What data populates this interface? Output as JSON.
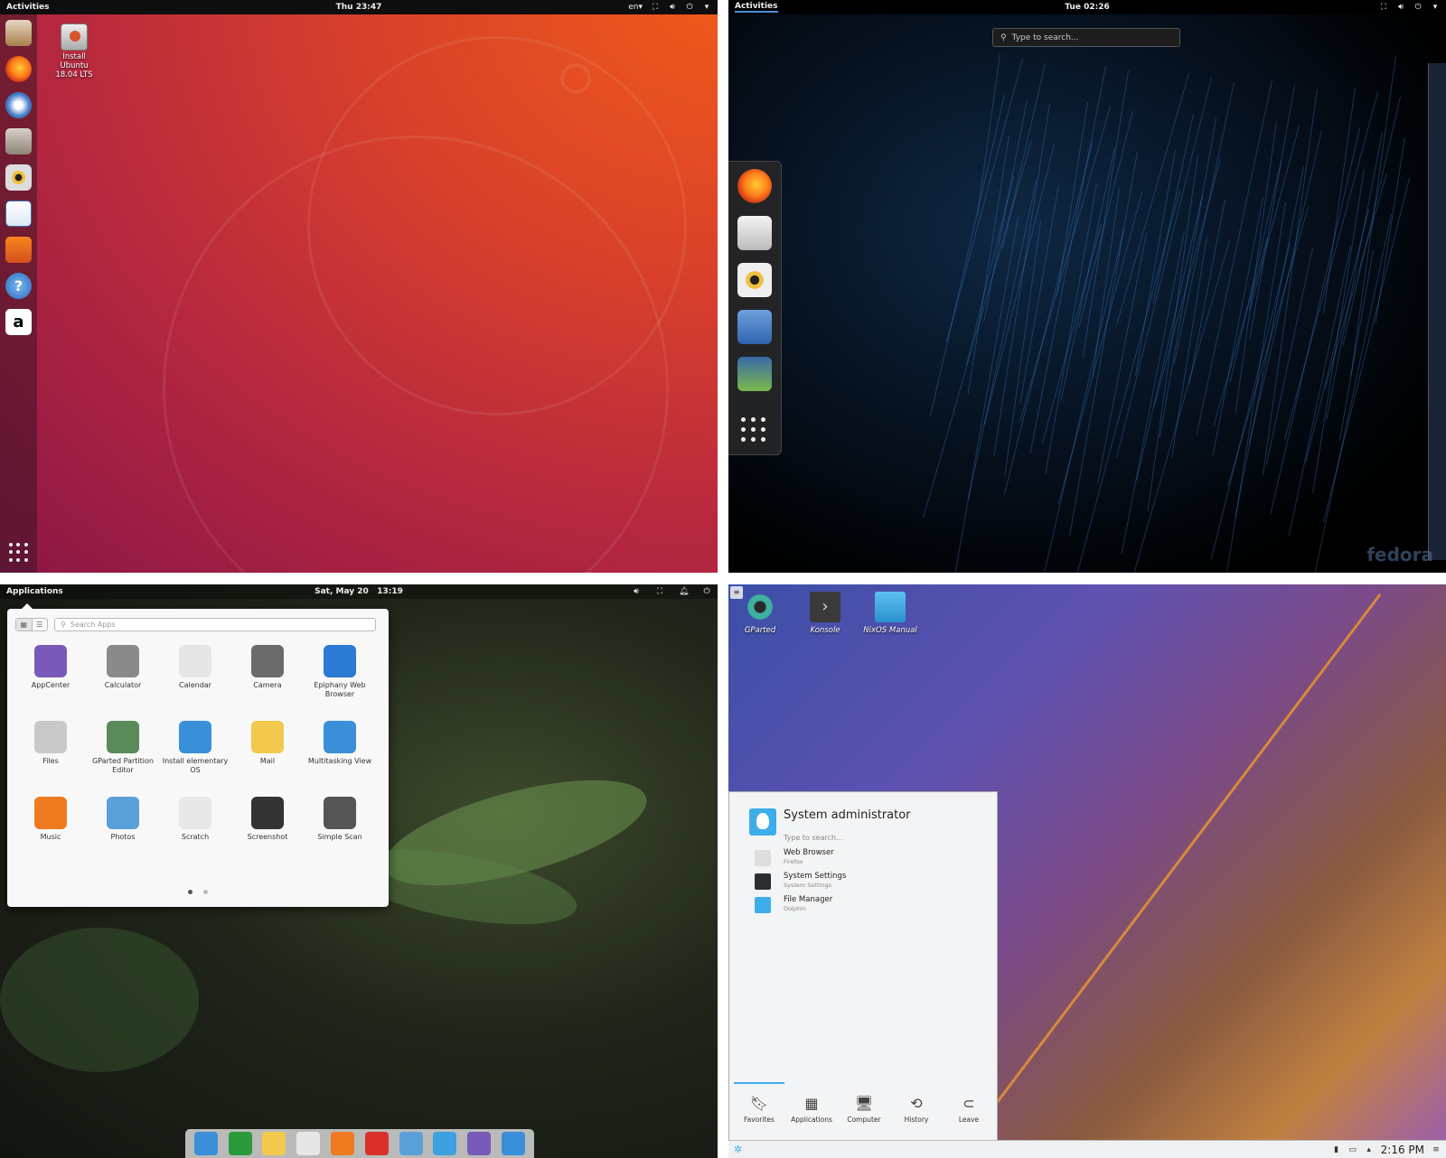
{
  "ubuntu": {
    "topbar": {
      "activities": "Activities",
      "clock": "Thu 23:47",
      "lang": "en",
      "caret": "▾"
    },
    "desktop_icon_label": "Install\nUbuntu\n18.04 LTS",
    "dock_icons": [
      "software-updater-icon",
      "firefox-icon",
      "thunderbird-icon",
      "files-icon",
      "rhythmbox-icon",
      "libreoffice-writer-icon",
      "ubuntu-software-icon",
      "help-icon",
      "amazon-icon"
    ],
    "colors": {
      "accent": "#e95420",
      "background_bottom": "#77216f"
    }
  },
  "fedora": {
    "topbar": {
      "activities": "Activities",
      "clock": "Tue 02:26"
    },
    "search_placeholder": "Type to search...",
    "dock_icons": [
      "firefox-icon",
      "evolution-icon",
      "rhythmbox-icon",
      "files-icon",
      "fedora-installer-icon"
    ],
    "watermark": "fedora"
  },
  "elementary": {
    "topbar": {
      "applications": "Applications",
      "date": "Sat, May 20",
      "time": "13:19"
    },
    "search_placeholder": "Search Apps",
    "apps": [
      {
        "label": "AppCenter",
        "color": "#7a5ab8"
      },
      {
        "label": "Calculator",
        "color": "#8a8a8a"
      },
      {
        "label": "Calendar",
        "color": "#e6e6e6"
      },
      {
        "label": "Camera",
        "color": "#6b6b6b"
      },
      {
        "label": "Epiphany Web Browser",
        "color": "#2b7bd4"
      },
      {
        "label": "Files",
        "color": "#c9c9c9"
      },
      {
        "label": "GParted Partition Editor",
        "color": "#5a8a5a"
      },
      {
        "label": "Install elementary OS",
        "color": "#3a8fd9"
      },
      {
        "label": "Mail",
        "color": "#f2c94c"
      },
      {
        "label": "Multitasking View",
        "color": "#3b8fd8"
      },
      {
        "label": "Music",
        "color": "#f07a20"
      },
      {
        "label": "Photos",
        "color": "#5aa0d8"
      },
      {
        "label": "Scratch",
        "color": "#e8e8e8"
      },
      {
        "label": "Screenshot",
        "color": "#333333"
      },
      {
        "label": "Simple Scan",
        "color": "#555555"
      }
    ],
    "dock_colors": [
      "#3b8fd8",
      "#2b9a3b",
      "#f2c94c",
      "#e6e6e6",
      "#f07a20",
      "#d9302c",
      "#5aa0d8",
      "#3da0e0",
      "#7a5ab8",
      "#3a8fd9"
    ]
  },
  "kde": {
    "desktop_icons": [
      {
        "label": "GParted",
        "color": "#3a6a6a"
      },
      {
        "label": "Konsole",
        "color": "#3a3a3a"
      },
      {
        "label": "NixOS Manual",
        "color": "#3daee9"
      }
    ],
    "user": "System administrator",
    "search_placeholder": "Type to search...",
    "favorites": [
      {
        "title": "Web Browser",
        "subtitle": "Firefox",
        "color": "#dddddd"
      },
      {
        "title": "System Settings",
        "subtitle": "System Settings",
        "color": "#2a2e32"
      },
      {
        "title": "File Manager",
        "subtitle": "Dolphin",
        "color": "#3daee9"
      }
    ],
    "tabs": [
      {
        "label": "Favorites",
        "glyph": "🔖︎"
      },
      {
        "label": "Applications",
        "glyph": "▦"
      },
      {
        "label": "Computer",
        "glyph": "🖥︎"
      },
      {
        "label": "History",
        "glyph": "⟲"
      },
      {
        "label": "Leave",
        "glyph": "⊂"
      }
    ],
    "clock": "2:16 PM",
    "colors": {
      "accent": "#3daee9"
    }
  }
}
